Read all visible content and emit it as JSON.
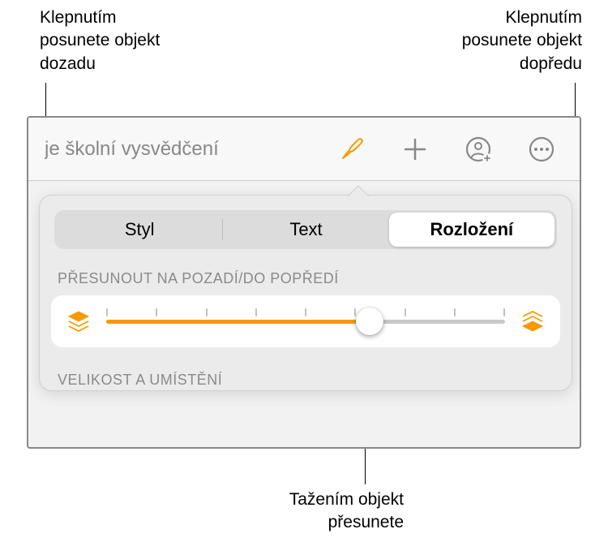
{
  "callouts": {
    "top_left": "Klepnutím\nposunete objekt\ndozadu",
    "top_right": "Klepnutím\nposunete objekt\ndopředu",
    "bottom": "Tažením objekt\npřesunete"
  },
  "toolbar": {
    "title": "je školní vysvědčení"
  },
  "segmented": {
    "style": "Styl",
    "text": "Text",
    "layout": "Rozložení"
  },
  "sections": {
    "move_back_front": "PŘESUNOUT NA POZADÍ/DO POPŘEDÍ",
    "size_position": "VELIKOST A UMÍSTĚNÍ"
  },
  "icons": {
    "brush": "brush-icon",
    "plus": "plus-icon",
    "collaborate": "collaborate-icon",
    "more": "more-icon",
    "back_layers": "back-layers-icon",
    "front_layers": "front-layers-icon"
  }
}
